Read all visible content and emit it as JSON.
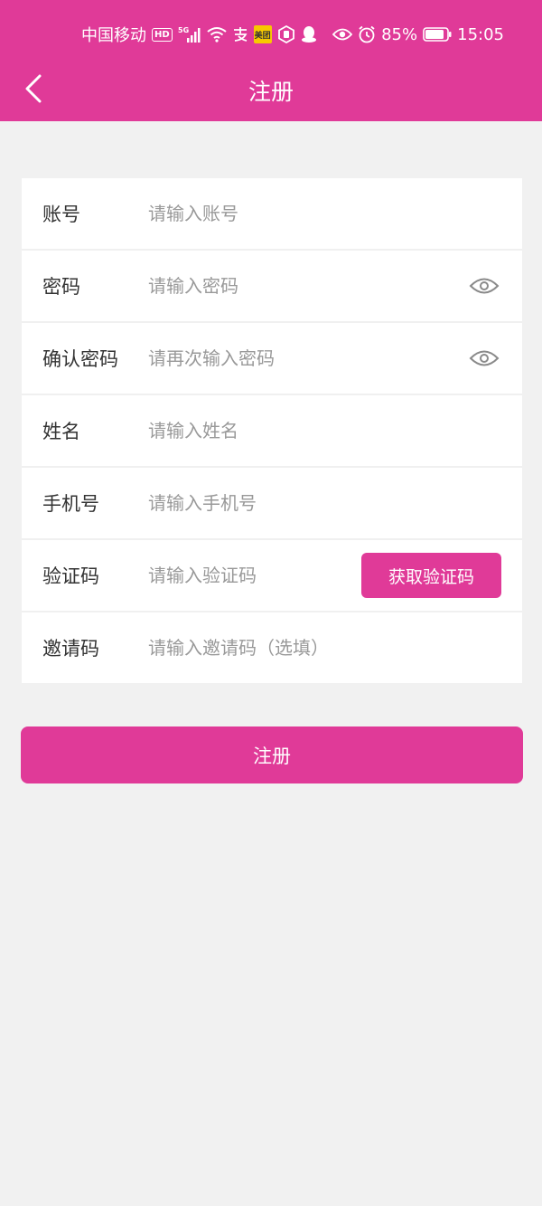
{
  "colors": {
    "accent": "#e03a98",
    "background": "#f1f1f1",
    "card": "#ffffff",
    "label": "#333333",
    "placeholder": "#999999"
  },
  "status_bar": {
    "carrier": "中国移动",
    "hd": "HD",
    "network": "5G",
    "meituan": "美团",
    "battery": "85%",
    "time": "15:05",
    "icons": [
      "signal-icon",
      "wifi-icon",
      "alipay-icon",
      "meituan-icon",
      "app-icon",
      "qq-icon",
      "eye-icon",
      "alarm-icon",
      "battery-icon"
    ]
  },
  "header": {
    "back_icon": "chevron-left-icon",
    "title": "注册"
  },
  "form": {
    "account": {
      "label": "账号",
      "placeholder": "请输入账号",
      "value": ""
    },
    "password": {
      "label": "密码",
      "placeholder": "请输入密码",
      "value": "",
      "toggle_icon": "eye-icon"
    },
    "confirm_password": {
      "label": "确认密码",
      "placeholder": "请再次输入密码",
      "value": "",
      "toggle_icon": "eye-icon"
    },
    "name": {
      "label": "姓名",
      "placeholder": "请输入姓名",
      "value": ""
    },
    "phone": {
      "label": "手机号",
      "placeholder": "请输入手机号",
      "value": ""
    },
    "verify_code": {
      "label": "验证码",
      "placeholder": "请输入验证码",
      "value": "",
      "button_label": "获取验证码"
    },
    "invite_code": {
      "label": "邀请码",
      "placeholder": "请输入邀请码（选填）",
      "value": ""
    }
  },
  "submit": {
    "label": "注册"
  }
}
